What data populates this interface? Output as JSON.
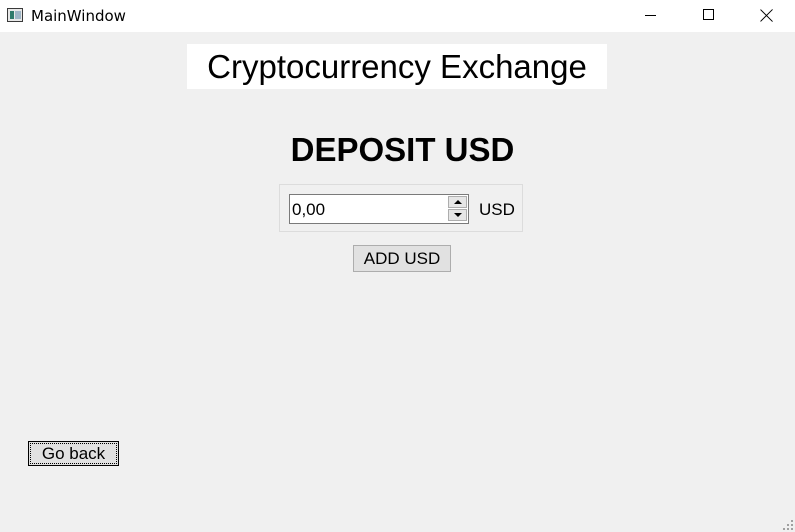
{
  "window": {
    "title": "MainWindow",
    "icon": "app-window-icon",
    "controls": [
      "minimize-icon",
      "maximize-icon",
      "close-icon"
    ]
  },
  "header": {
    "title": "Cryptocurrency Exchange"
  },
  "main": {
    "heading": "DEPOSIT USD",
    "amount_input": {
      "value": "0,00"
    },
    "currency_label": "USD",
    "add_button_label": "ADD USD",
    "back_button_label": "Go back"
  }
}
